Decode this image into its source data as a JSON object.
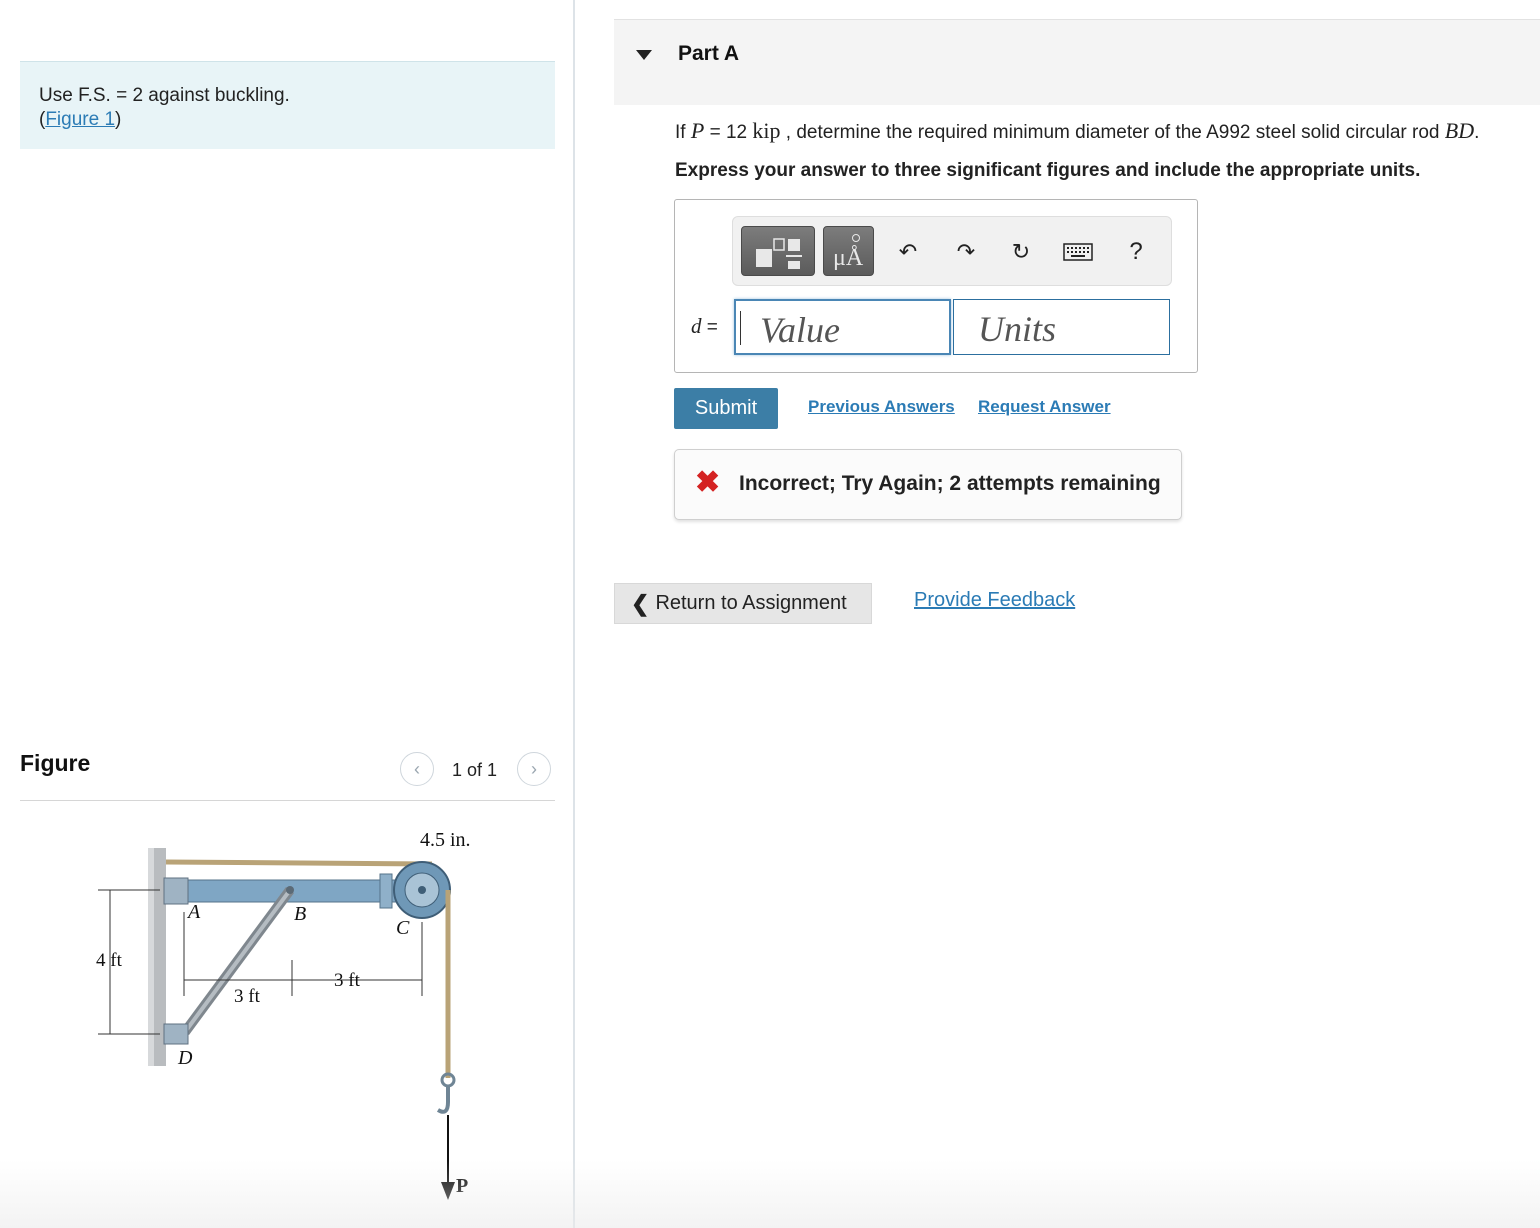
{
  "intro": {
    "text": "Use F.S. = 2 against buckling.",
    "open_paren": "(",
    "figure_link": "Figure 1",
    "close_paren": ")"
  },
  "figure_panel": {
    "title": "Figure",
    "prev_icon": "chevron-left-icon",
    "next_icon": "chevron-right-icon",
    "counter": "1 of 1",
    "diagram": {
      "labels": {
        "A": "A",
        "B": "B",
        "C": "C",
        "D": "D",
        "P": "P",
        "pulley_size": "4.5 in.",
        "height": "4 ft",
        "span_ab": "3 ft",
        "span_bc": "3 ft"
      }
    }
  },
  "part": {
    "title": "Part A",
    "caret_icon": "caret-down-icon",
    "question": {
      "prefix": "If ",
      "var_p": "P",
      "equals": " = 12 ",
      "unit": "kip",
      "middle": " , determine the required minimum diameter of the A992 steel solid circular rod ",
      "var_bd": "BD",
      "suffix": "."
    },
    "instruction": "Express your answer to three significant figures and include the appropriate units."
  },
  "toolbar": {
    "template_icon": "templates-icon",
    "units_glyph": "μÅ",
    "undo_icon": "undo-icon",
    "redo_icon": "redo-icon",
    "reset_icon": "reset-icon",
    "keyboard_icon": "keyboard-icon",
    "help_label": "?"
  },
  "answer": {
    "var": "d",
    "equals": " =",
    "value_placeholder": "Value",
    "units_placeholder": "Units"
  },
  "actions": {
    "submit": "Submit",
    "previous_answers": "Previous Answers",
    "request_answer": "Request Answer"
  },
  "feedback": {
    "icon": "x-icon",
    "text": "Incorrect; Try Again; 2 attempts remaining"
  },
  "footer": {
    "return": "Return to Assignment",
    "provide_feedback": "Provide Feedback"
  },
  "colors": {
    "link": "#2b7bb5",
    "submit_bg": "#3c7ea6",
    "error": "#d42222",
    "intro_bg": "#e8f4f7",
    "beam": "#7fa6c4"
  }
}
